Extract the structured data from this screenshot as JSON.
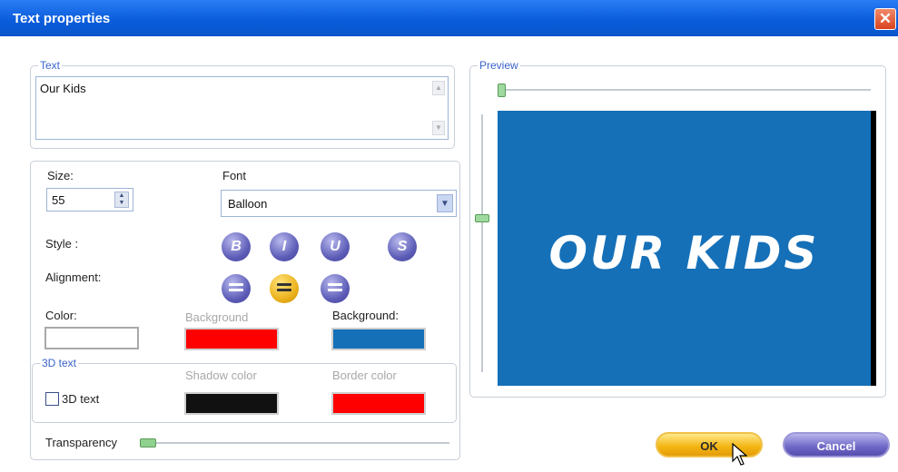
{
  "window": {
    "title": "Text properties",
    "close_icon": "✕"
  },
  "text_group": {
    "legend": "Text",
    "value": "Our Kids"
  },
  "size": {
    "label": "Size:",
    "value": "55"
  },
  "font": {
    "label": "Font",
    "value": "Balloon"
  },
  "style": {
    "label": "Style :",
    "buttons": [
      "B",
      "I",
      "U",
      "S"
    ]
  },
  "alignment": {
    "label": "Alignment:",
    "selected": "center"
  },
  "color": {
    "label": "Color:",
    "value": "#ffffff"
  },
  "background_dim": {
    "label": "Background",
    "value": "#ff0000"
  },
  "background": {
    "label": "Background:",
    "value": "#1570b8"
  },
  "three_d": {
    "legend": "3D text",
    "checkbox_label": "3D text",
    "checked": false,
    "shadow_label": "Shadow color",
    "shadow_color": "#111111",
    "border_label": "Border color",
    "border_color": "#ff0000"
  },
  "transparency": {
    "label": "Transparency",
    "value": 0
  },
  "preview": {
    "legend": "Preview",
    "text": "OUR KIDS",
    "background": "#1570b8"
  },
  "buttons": {
    "ok": "OK",
    "cancel": "Cancel"
  }
}
